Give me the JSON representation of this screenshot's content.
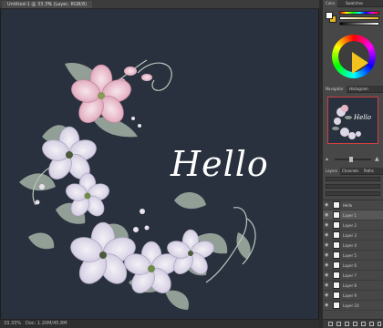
{
  "document": {
    "tab_title": "Untitled-1 @ 33.3% (Layer, RGB/8)",
    "tab_close": "×"
  },
  "canvas": {
    "background_color": "#28313d",
    "text_layer": "Hello"
  },
  "status_bar": {
    "zoom": "33.33%",
    "doc_info": "Doc: 1.20M/45.8M"
  },
  "panels": {
    "color": {
      "tabs": [
        "Color",
        "Swatches"
      ],
      "foreground": "#ffffff",
      "background": "#e6b620"
    },
    "navigator": {
      "tabs": [
        "Navigator",
        "Histogram"
      ],
      "thumbnail_text": "Hello"
    },
    "layers": {
      "tabs": [
        "Layers",
        "Channels",
        "Paths"
      ],
      "rows": [
        {
          "name": "Hello",
          "selected": false
        },
        {
          "name": "Layer 1",
          "selected": true
        },
        {
          "name": "Layer 2",
          "selected": false
        },
        {
          "name": "Layer 3",
          "selected": false
        },
        {
          "name": "Layer 4",
          "selected": false
        },
        {
          "name": "Layer 5",
          "selected": false
        },
        {
          "name": "Layer 6",
          "selected": false
        },
        {
          "name": "Layer 7",
          "selected": false
        },
        {
          "name": "Layer 8",
          "selected": false
        },
        {
          "name": "Layer 9",
          "selected": false
        },
        {
          "name": "Layer 10",
          "selected": false
        }
      ]
    }
  }
}
